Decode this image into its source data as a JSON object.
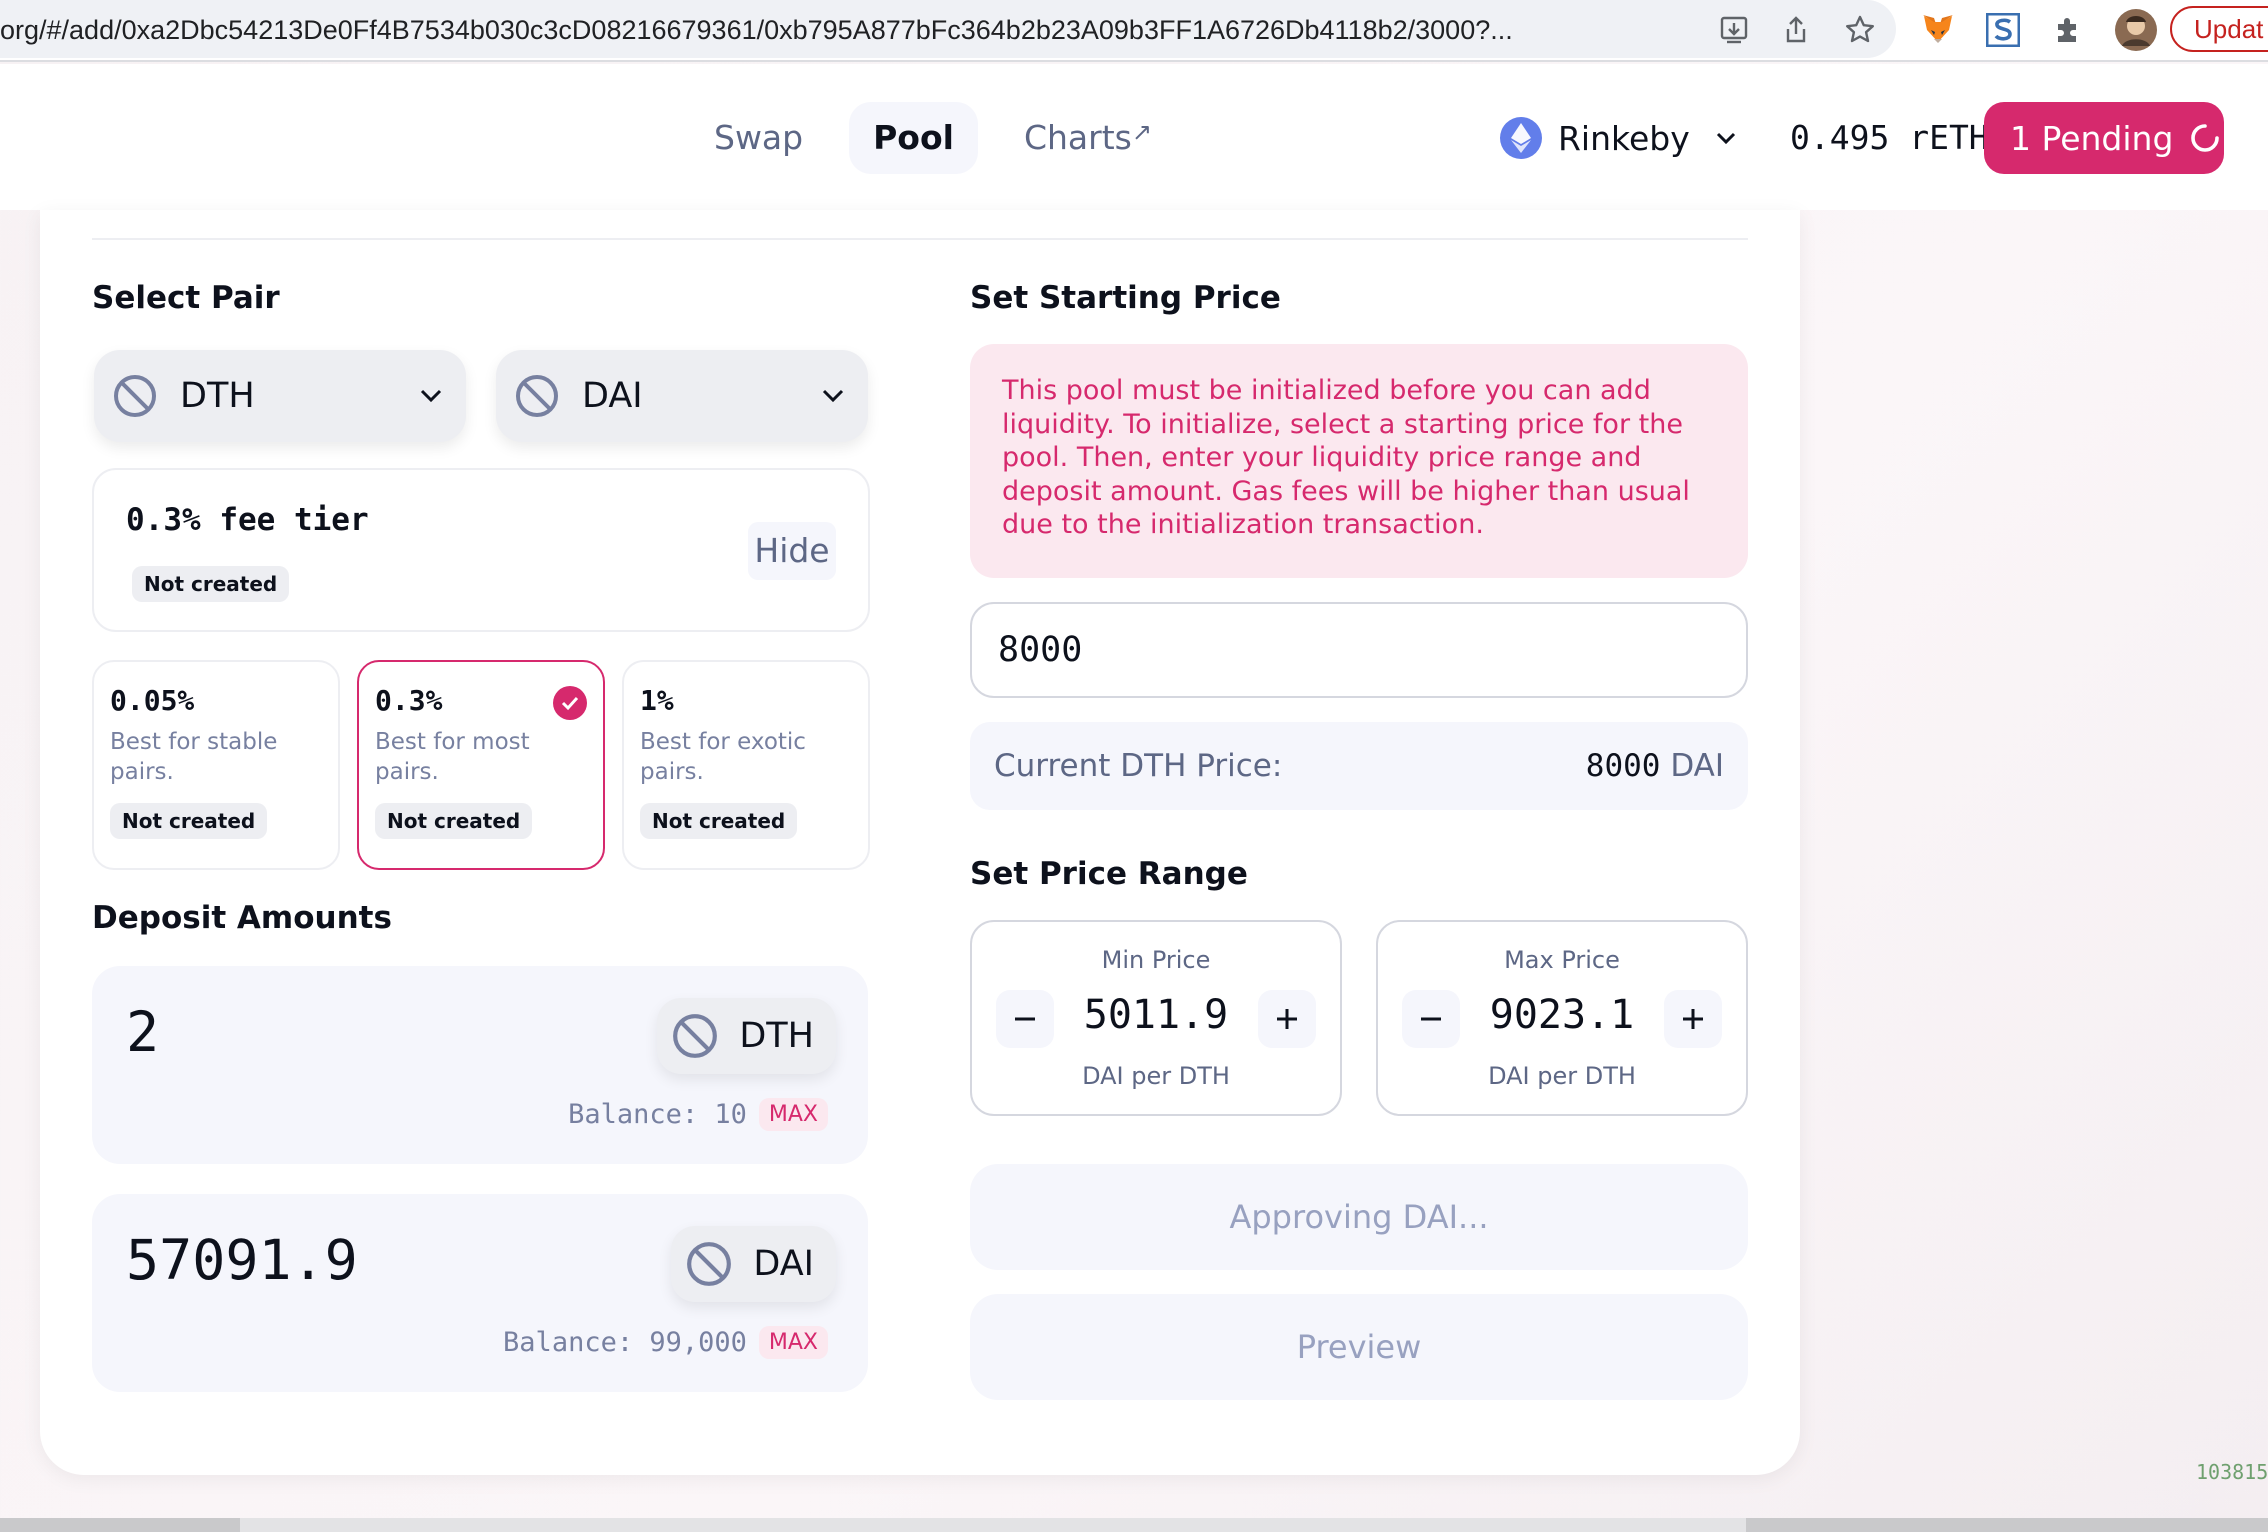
{
  "browser": {
    "url": "org/#/add/0xa2Dbc54213De0Ff4B7534b030c3cD08216679361/0xb795A877bFc364b2b23A09b3FF1A6726Db4118b2/3000?...",
    "update_label": "Updat"
  },
  "nav": {
    "swap": "Swap",
    "pool": "Pool",
    "charts": "Charts",
    "charts_arrow": "↗"
  },
  "network": {
    "name": "Rinkeby"
  },
  "wallet": {
    "balance": "0.495 rETH",
    "pending": "1 Pending"
  },
  "select_pair": {
    "title": "Select Pair",
    "token_a": "DTH",
    "token_b": "DAI"
  },
  "fee": {
    "selected_label": "0.3% fee tier",
    "selected_status": "Not created",
    "hide_label": "Hide",
    "tiers": [
      {
        "pct": "0.05%",
        "desc": "Best for stable pairs.",
        "status": "Not created"
      },
      {
        "pct": "0.3%",
        "desc": "Best for most pairs.",
        "status": "Not created"
      },
      {
        "pct": "1%",
        "desc": "Best for exotic pairs.",
        "status": "Not created"
      }
    ]
  },
  "deposit": {
    "title": "Deposit Amounts",
    "a": {
      "amount": "2",
      "token": "DTH",
      "balance": "Balance: 10",
      "max": "MAX"
    },
    "b": {
      "amount": "57091.9",
      "token": "DAI",
      "balance": "Balance: 99,000",
      "max": "MAX"
    }
  },
  "starting_price": {
    "title": "Set Starting Price",
    "warning": "This pool must be initialized before you can add liquidity. To initialize, select a starting price for the pool. Then, enter your liquidity price range and deposit amount. Gas fees will be higher than usual due to the initialization transaction.",
    "input_value": "8000",
    "current_label": "Current DTH Price:",
    "current_value": "8000",
    "current_unit": "DAI"
  },
  "price_range": {
    "title": "Set Price Range",
    "min": {
      "label": "Min Price",
      "value": "5011.9",
      "unit": "DAI per DTH"
    },
    "max": {
      "label": "Max Price",
      "value": "9023.1",
      "unit": "DAI per DTH"
    }
  },
  "actions": {
    "approving": "Approving DAI...",
    "preview": "Preview"
  },
  "side_text": "103815",
  "colors": {
    "accent": "#d6296d",
    "accent_soft": "#fbe8ef",
    "eth": "#627eea",
    "surface": "#f5f6fc"
  }
}
